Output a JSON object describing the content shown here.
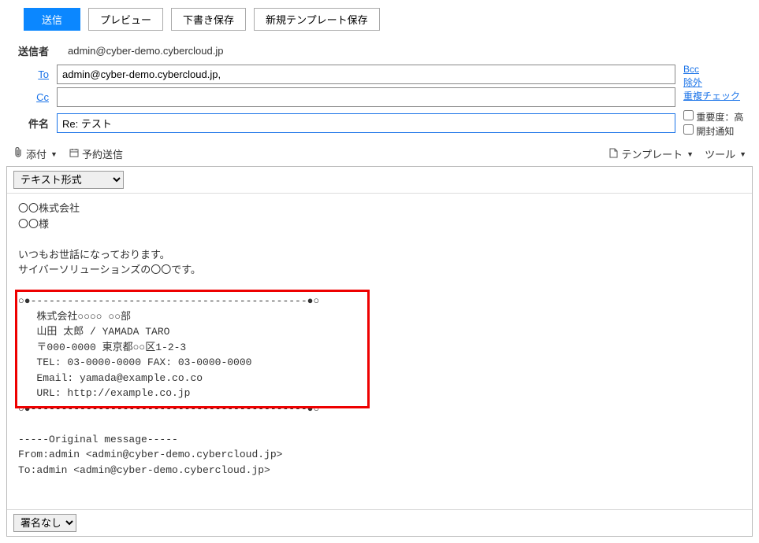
{
  "toolbar": {
    "send": "送信",
    "preview": "プレビュー",
    "draft": "下書き保存",
    "template": "新規テンプレート保存"
  },
  "labels": {
    "sender": "送信者",
    "to": "To",
    "cc": "Cc",
    "subject": "件名"
  },
  "sender_value": "admin@cyber-demo.cybercloud.jp",
  "to_value": "admin@cyber-demo.cybercloud.jp,",
  "cc_value": "",
  "subject_value": "Re: テスト",
  "side_links": {
    "bcc": "Bcc",
    "exclude": "除外",
    "dupcheck": "重複チェック"
  },
  "side_checks": {
    "priority": "重要度：高",
    "receipt": "開封通知"
  },
  "sub_toolbar": {
    "attach": "添付",
    "schedule": "予約送信",
    "template_menu": "テンプレート",
    "tool_menu": "ツール"
  },
  "format_options": [
    "テキスト形式"
  ],
  "format_selected": "テキスト形式",
  "body_pre": "〇〇株式会社\n〇〇様\n\nいつもお世話になっております。\nサイバーソリューションズの〇〇です。\n\n",
  "body_sig": "○●---------------------------------------------●○\n   株式会社○○○○ ○○部\n   山田 太郎 / YAMADA TARO\n   〒000-0000 東京都○○区1-2-3\n   TEL: 03-0000-0000 FAX: 03-0000-0000\n   Email: yamada@example.co.co\n   URL: http://example.co.jp\n○●---------------------------------------------●○",
  "body_post": "\n\n-----Original message-----\nFrom:admin <admin@cyber-demo.cybercloud.jp>\nTo:admin <admin@cyber-demo.cybercloud.jp>",
  "signature_selected": "署名なし"
}
